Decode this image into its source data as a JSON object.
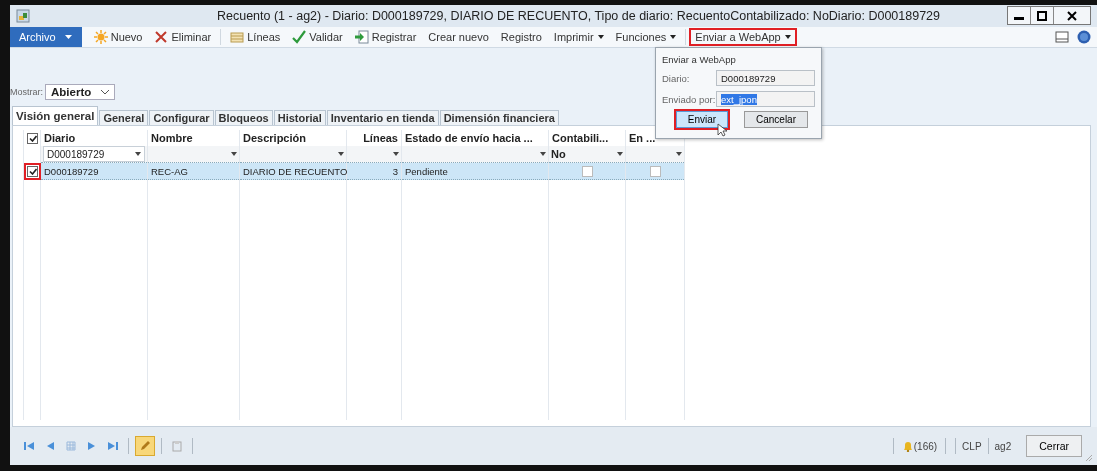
{
  "window": {
    "title": "Recuento (1 - ag2) - Diario: D000189729, DIARIO DE RECUENTO, Tipo de diario: RecuentoContabilizado: NoDiario: D000189729"
  },
  "toolbar": {
    "items": [
      {
        "label": "Archivo",
        "kind": "file",
        "selected": false
      },
      {
        "label": "Nuevo",
        "kind": "button",
        "selected": false
      },
      {
        "label": "Eliminar",
        "kind": "button",
        "selected": false
      },
      {
        "label": "Líneas",
        "kind": "button",
        "selected": false
      },
      {
        "label": "Validar",
        "kind": "button",
        "selected": false
      },
      {
        "label": "Registrar",
        "kind": "button",
        "selected": false
      },
      {
        "label": "Crear nuevo",
        "kind": "button",
        "selected": false
      },
      {
        "label": "Registro",
        "kind": "button",
        "selected": false
      },
      {
        "label": "Imprimir",
        "kind": "menu",
        "selected": false
      },
      {
        "label": "Funciones",
        "kind": "menu",
        "selected": false
      },
      {
        "label": "Enviar a WebApp",
        "kind": "menu",
        "selected": true
      }
    ]
  },
  "filter": {
    "label": "Mostrar:",
    "value": "Abierto"
  },
  "tabs": [
    {
      "label": "Visión general",
      "selected": true
    },
    {
      "label": "General",
      "selected": false
    },
    {
      "label": "Configurar",
      "selected": false
    },
    {
      "label": "Bloqueos",
      "selected": false
    },
    {
      "label": "Historial",
      "selected": false
    },
    {
      "label": "Inventario en tienda",
      "selected": false
    },
    {
      "label": "Dimensión financiera",
      "selected": false
    }
  ],
  "table": {
    "all_checked": true,
    "columns": [
      {
        "label": "Diario",
        "filter": "D000189729"
      },
      {
        "label": "Nombre"
      },
      {
        "label": "Descripción"
      },
      {
        "label": "Líneas"
      },
      {
        "label": "Estado de envío hacia ..."
      },
      {
        "label": "Contabili...",
        "filter": "No"
      },
      {
        "label": "En ..."
      }
    ],
    "rows": [
      {
        "selected": true,
        "checked": true,
        "cells": [
          {
            "kind": "text",
            "text": "D000189729"
          },
          {
            "kind": "text",
            "text": "REC-AG"
          },
          {
            "kind": "text",
            "text": "DIARIO DE RECUENTO"
          },
          {
            "kind": "text",
            "text": "3"
          },
          {
            "kind": "text",
            "text": "Pendiente"
          },
          {
            "kind": "checkbox",
            "checked": false
          },
          {
            "kind": "checkbox",
            "checked": false
          }
        ]
      }
    ]
  },
  "popup": {
    "title": "Enviar a WebApp",
    "fields": [
      {
        "label": "Diario:",
        "value": "D000189729",
        "text_selected": false
      },
      {
        "label": "Enviado por:",
        "value": "ext_jpon",
        "text_selected": true
      }
    ],
    "buttons": [
      {
        "label": "Enviar",
        "focused": true
      },
      {
        "label": "Cancelar",
        "focused": false
      }
    ]
  },
  "status_bar": {
    "notifications": "(166)",
    "currency": "CLP",
    "company": "ag2",
    "close": "Cerrar"
  }
}
